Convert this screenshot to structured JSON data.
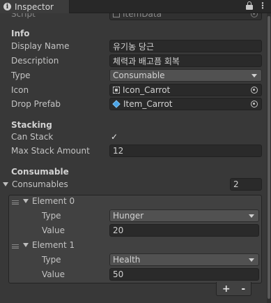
{
  "tab": {
    "title": "Inspector",
    "info_icon": "info-icon",
    "lock_icon": "lock-icon",
    "menu_icon": "kebab-menu-icon"
  },
  "script_row": {
    "label": "Script",
    "value": "ItemData"
  },
  "info": {
    "header": "Info",
    "display_name_label": "Display Name",
    "display_name_value": "유기농 당근",
    "description_label": "Description",
    "description_value": "체력과 배고픔 회복",
    "type_label": "Type",
    "type_value": "Consumable",
    "icon_label": "Icon",
    "icon_value": "Icon_Carrot",
    "drop_prefab_label": "Drop Prefab",
    "drop_prefab_value": "Item_Carrot"
  },
  "stacking": {
    "header": "Stacking",
    "can_stack_label": "Can Stack",
    "can_stack_checked": true,
    "can_stack_mark": "✓",
    "max_stack_label": "Max Stack Amount",
    "max_stack_value": "12"
  },
  "consumable": {
    "header": "Consumable",
    "consumables_label": "Consumables",
    "count": "2",
    "elements": [
      {
        "label": "Element 0",
        "type_label": "Type",
        "type_value": "Hunger",
        "value_label": "Value",
        "value": "20"
      },
      {
        "label": "Element 1",
        "type_label": "Type",
        "type_value": "Health",
        "value_label": "Value",
        "value": "50"
      }
    ],
    "add_label": "+",
    "remove_label": "-"
  }
}
